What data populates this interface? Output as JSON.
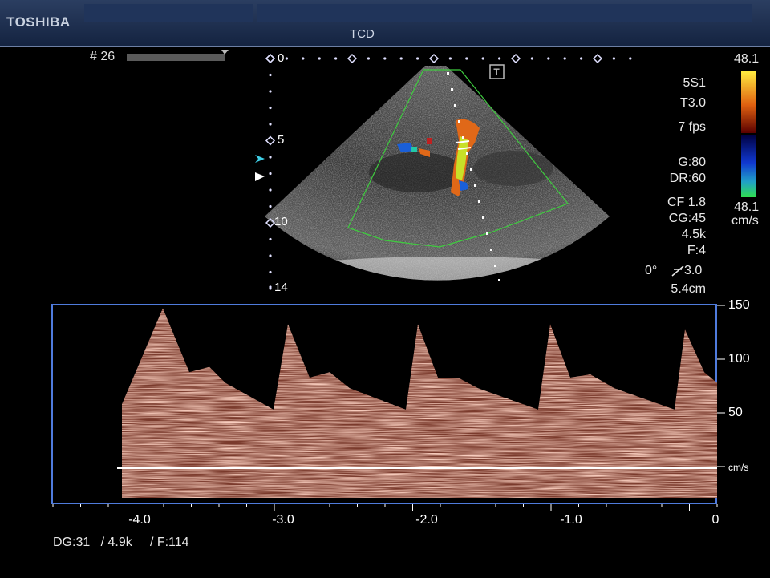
{
  "header": {
    "brand": "TOSHIBA",
    "mode": "TCD"
  },
  "frame": {
    "label": "# 26"
  },
  "depth_scale": {
    "labels": [
      "0",
      "5",
      "10",
      "14"
    ]
  },
  "params": {
    "probe": "5S1",
    "thi": "T3.0",
    "fps": "7 fps",
    "gain": "G:80",
    "dr": "DR:60",
    "cf": "CF 1.8",
    "cg": "CG:45",
    "prf": "4.5k",
    "filter": "F:4",
    "angle": "0°",
    "angle_val": "3.0",
    "depth": "5.4cm"
  },
  "color_bar": {
    "top": "48.1",
    "bottom": "48.1",
    "unit": "cm/s"
  },
  "spectral": {
    "velocity_scale": [
      "150",
      "100",
      "50"
    ],
    "unit": "cm/s",
    "time_ticks": [
      "-4.0",
      "-3.0",
      "-2.0",
      "-1.0",
      "0"
    ]
  },
  "footer": {
    "text": "DG:31   / 4.9k     / F:114"
  }
}
